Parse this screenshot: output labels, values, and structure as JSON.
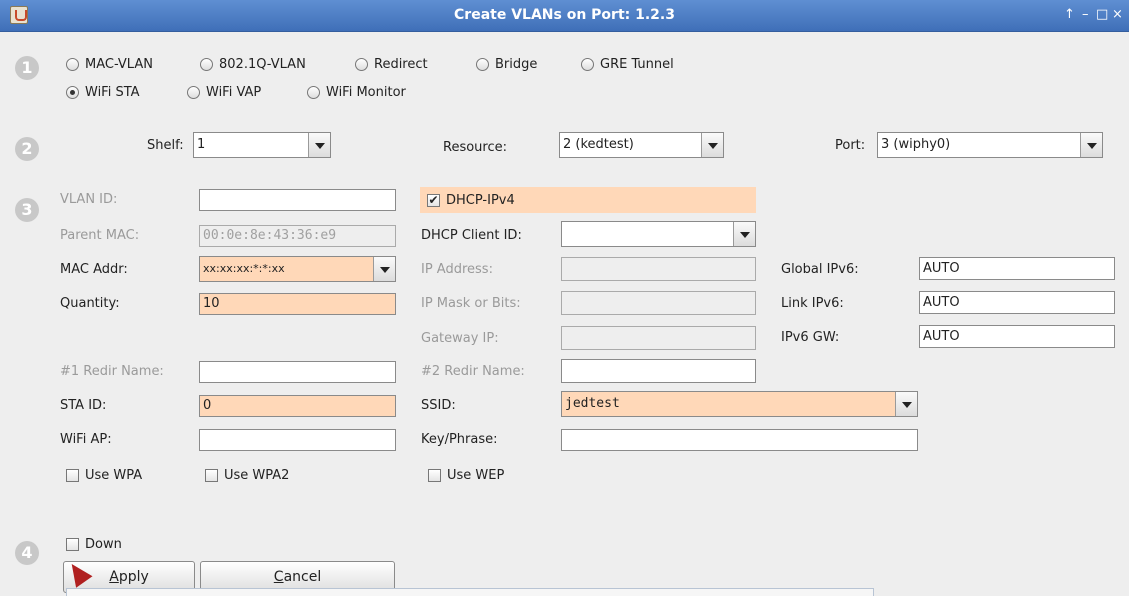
{
  "window": {
    "title": "Create VLANs on Port: 1.2.3",
    "controls": {
      "pin": "↑",
      "minimize": "–",
      "maximize": "□",
      "close": "×"
    }
  },
  "steps": [
    "1",
    "2",
    "3",
    "4"
  ],
  "vlan_types": [
    {
      "label": "MAC-VLAN",
      "selected": false
    },
    {
      "label": "802.1Q-VLAN",
      "selected": false
    },
    {
      "label": "Redirect",
      "selected": false
    },
    {
      "label": "Bridge",
      "selected": false
    },
    {
      "label": "GRE Tunnel",
      "selected": false
    },
    {
      "label": "WiFi STA",
      "selected": true
    },
    {
      "label": "WiFi VAP",
      "selected": false
    },
    {
      "label": "WiFi Monitor",
      "selected": false
    }
  ],
  "location": {
    "shelf_label": "Shelf:",
    "shelf_value": "1",
    "resource_label": "Resource:",
    "resource_value": "2 (kedtest)",
    "port_label": "Port:",
    "port_value": "3 (wiphy0)"
  },
  "form": {
    "vlan_id": {
      "label": "VLAN ID:",
      "value": ""
    },
    "parent_mac": {
      "label": "Parent MAC:",
      "value": "00:0e:8e:43:36:e9"
    },
    "mac_addr": {
      "label": "MAC Addr:",
      "value": "xx:xx:xx:*:*:xx"
    },
    "quantity": {
      "label": "Quantity:",
      "value": "10"
    },
    "redir1": {
      "label": "#1 Redir Name:",
      "value": ""
    },
    "sta_id": {
      "label": "STA ID:",
      "value": "0"
    },
    "wifi_ap": {
      "label": "WiFi AP:",
      "value": ""
    },
    "use_wpa": {
      "label": "Use WPA",
      "checked": false
    },
    "use_wpa2": {
      "label": "Use WPA2",
      "checked": false
    },
    "dhcp_ipv4": {
      "label": "DHCP-IPv4",
      "checked": true,
      "mark": "✔"
    },
    "dhcp_client_id": {
      "label": "DHCP Client ID:",
      "value": ""
    },
    "ip_address": {
      "label": "IP Address:",
      "value": ""
    },
    "ip_mask": {
      "label": "IP Mask or Bits:",
      "value": ""
    },
    "gateway_ip": {
      "label": "Gateway IP:",
      "value": ""
    },
    "redir2": {
      "label": "#2 Redir Name:",
      "value": ""
    },
    "ssid": {
      "label": "SSID:",
      "value": "jedtest"
    },
    "key_phrase": {
      "label": "Key/Phrase:",
      "value": ""
    },
    "use_wep": {
      "label": "Use WEP",
      "checked": false
    },
    "global_ipv6": {
      "label": "Global IPv6:",
      "value": "AUTO"
    },
    "link_ipv6": {
      "label": "Link IPv6:",
      "value": "AUTO"
    },
    "ipv6_gw": {
      "label": "IPv6 GW:",
      "value": "AUTO"
    }
  },
  "down": {
    "label": "Down",
    "checked": false
  },
  "buttons": {
    "apply": {
      "mnemonic": "A",
      "rest": "pply"
    },
    "cancel": {
      "mnemonic": "C",
      "rest": "ancel"
    }
  },
  "colors": {
    "titlebar": "#4a7cc4",
    "highlight": "#ffd8b8",
    "background": "#eeeeee"
  }
}
